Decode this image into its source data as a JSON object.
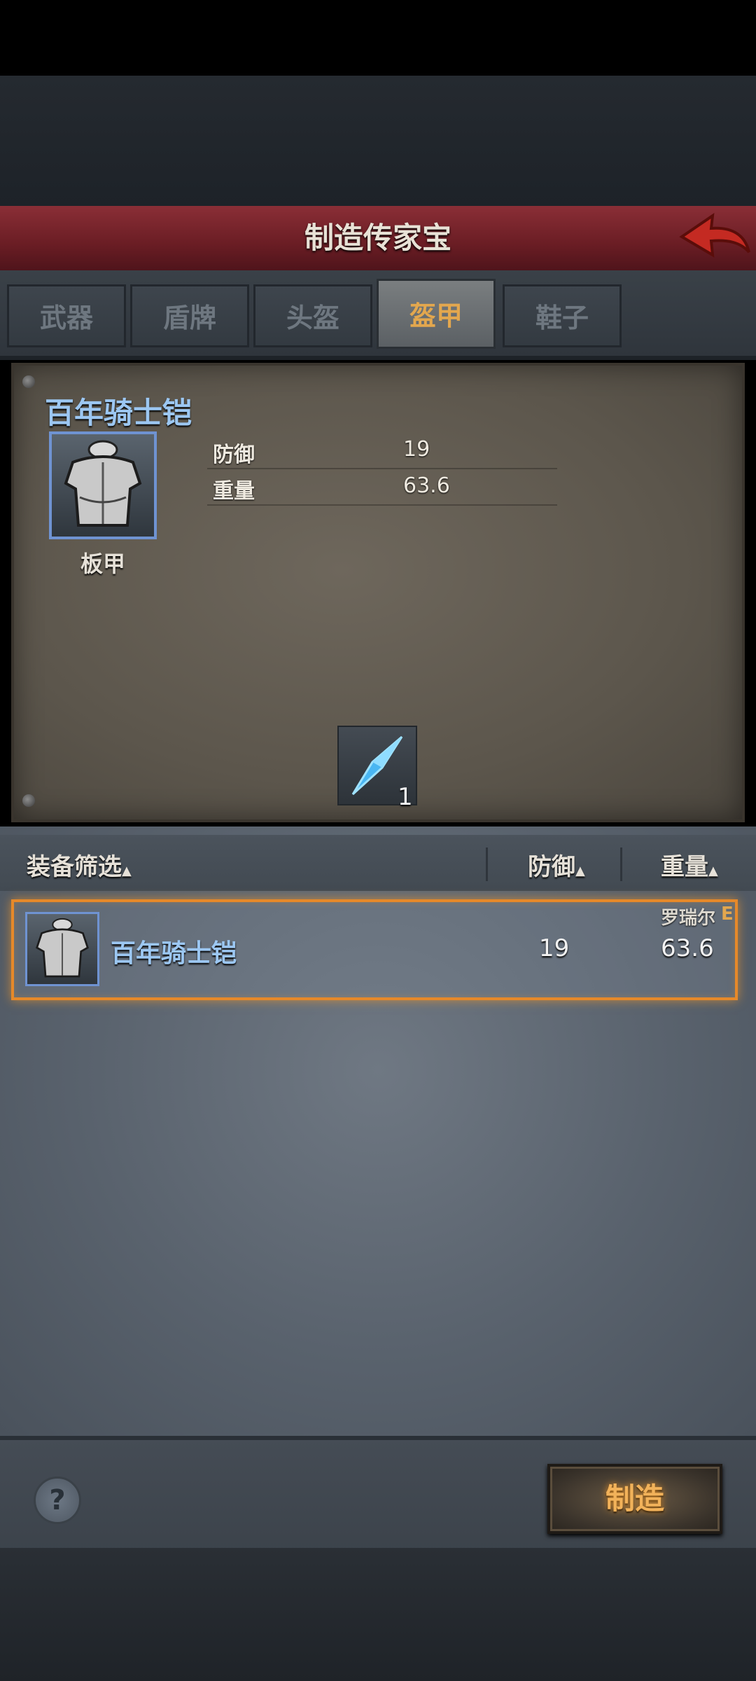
{
  "header": {
    "title": "制造传家宝",
    "back_icon": "back-arrow-icon"
  },
  "tabs": [
    {
      "label": "武器",
      "active": false
    },
    {
      "label": "盾牌",
      "active": false
    },
    {
      "label": "头盔",
      "active": false
    },
    {
      "label": "盔甲",
      "active": true
    },
    {
      "label": "鞋子",
      "active": false
    }
  ],
  "detail": {
    "name": "百年骑士铠",
    "type": "板甲",
    "stats": [
      {
        "label": "防御",
        "value": "19"
      },
      {
        "label": "重量",
        "value": "63.6"
      }
    ],
    "material": {
      "icon": "blue-crystal-icon",
      "count": "1"
    }
  },
  "list": {
    "headers": {
      "filter": "装备筛选",
      "defense": "防御",
      "weight": "重量"
    },
    "rows": [
      {
        "name": "百年骑士铠",
        "defense": "19",
        "weight": "63.6",
        "owner": "罗瑞尔",
        "grade": "E",
        "selected": true
      }
    ]
  },
  "footer": {
    "help_icon": "help-icon",
    "help_symbol": "?",
    "make_label": "制造"
  },
  "colors": {
    "accent": "#e3a74e",
    "item_name": "#9cc7f2",
    "selection": "#e6892a",
    "title_bar": "#7a242c"
  }
}
